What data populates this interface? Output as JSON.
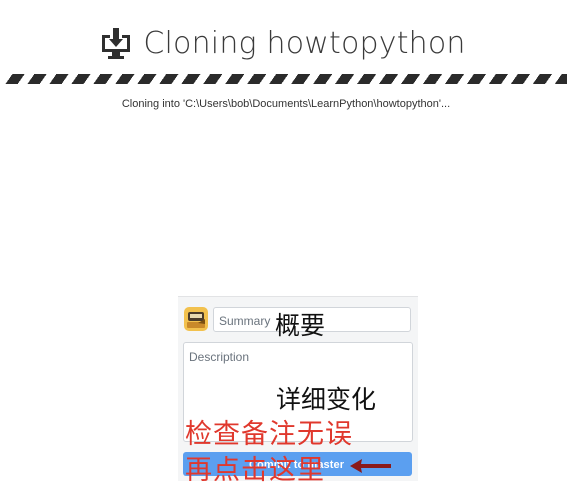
{
  "header": {
    "title": "Cloning howtopython",
    "icon": "download-to-desktop-icon"
  },
  "progress": {
    "style": "indeterminate-striped",
    "status": "Cloning into 'C:\\Users\\bob\\Documents\\LearnPython\\howtopython'..."
  },
  "commit": {
    "avatar": "user-avatar-icon",
    "summary_placeholder": "Summary",
    "description_placeholder": "Description",
    "button_label": "Commit to master"
  },
  "annotations": {
    "summary_note": "概要",
    "description_note": "详细变化",
    "check_note": "检查备注无误",
    "click_note": "再点击这里",
    "arrow": "left-arrow-icon"
  },
  "colors": {
    "accent_button": "#5b9ff0",
    "annotation_red": "#e0382d",
    "arrow_dark_red": "#8b1a1a"
  }
}
